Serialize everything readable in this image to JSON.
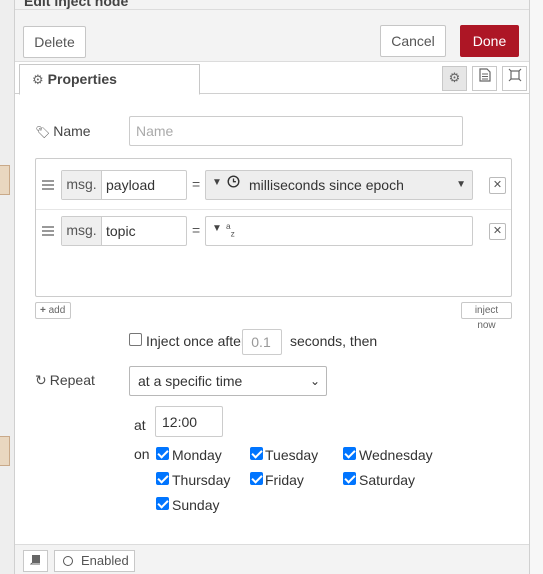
{
  "tray": {
    "title": "Edit inject node"
  },
  "toolbar": {
    "delete_label": "Delete",
    "cancel_label": "Cancel",
    "done_label": "Done",
    "done_color": "#ad1625"
  },
  "tabs": {
    "properties_label": "Properties",
    "properties_icon": "gear-icon",
    "icons": [
      "gear-icon",
      "document-icon",
      "frame-icon"
    ]
  },
  "name_field": {
    "label": "Name",
    "placeholder": "Name",
    "value": ""
  },
  "properties": [
    {
      "prefix": "msg.",
      "key": "payload",
      "eq": "=",
      "type_icon": "clock-icon",
      "value": "milliseconds since epoch"
    },
    {
      "prefix": "msg.",
      "key": "topic",
      "eq": "=",
      "type_icon": "string-az-icon",
      "type_glyph_a": "a",
      "type_glyph_z": "z",
      "value": ""
    }
  ],
  "actions": {
    "add_label": "add",
    "inject_now_label": "inject now"
  },
  "inject_once": {
    "checked": false,
    "label": "Inject once after",
    "seconds_value": "0.1",
    "suffix": "seconds, then"
  },
  "repeat": {
    "label": "Repeat",
    "selected": "at a specific time",
    "at_label": "at",
    "time_value": "12:00",
    "on_label": "on"
  },
  "days": [
    {
      "label": "Monday",
      "checked": true
    },
    {
      "label": "Tuesday",
      "checked": true
    },
    {
      "label": "Wednesday",
      "checked": true
    },
    {
      "label": "Thursday",
      "checked": true
    },
    {
      "label": "Friday",
      "checked": true
    },
    {
      "label": "Saturday",
      "checked": true
    },
    {
      "label": "Sunday",
      "checked": true
    }
  ],
  "footer": {
    "enabled_label": "Enabled"
  },
  "accent_checkbox": "#0075ff"
}
